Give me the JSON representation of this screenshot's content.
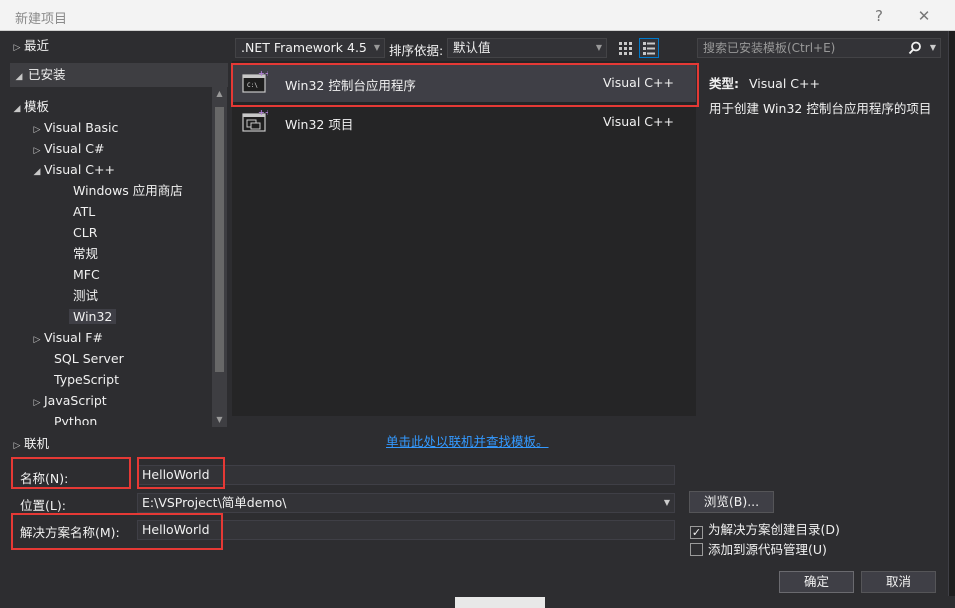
{
  "window": {
    "title": "新建项目",
    "help_glyph": "?",
    "close_glyph": "✕"
  },
  "tree": {
    "recent": "最近",
    "installed": "已安装",
    "templates": "模板",
    "items": [
      "Visual Basic",
      "Visual C#",
      "Visual C++",
      "Windows 应用商店",
      "ATL",
      "CLR",
      "常规",
      "MFC",
      "测试",
      "Win32",
      "Visual F#",
      "SQL Server",
      "TypeScript",
      "JavaScript",
      "Python"
    ],
    "online": "联机"
  },
  "toolbar": {
    "framework": ".NET Framework 4.5",
    "sort_label": "排序依据:",
    "sort_value": "默认值",
    "search_placeholder": "搜索已安装模板(Ctrl+E)"
  },
  "templates": [
    {
      "name": "Win32 控制台应用程序",
      "lang": "Visual C++",
      "icon": "console-app-icon"
    },
    {
      "name": "Win32 项目",
      "lang": "Visual C++",
      "icon": "win32-project-icon"
    }
  ],
  "online_link": "单击此处以联机并查找模板。",
  "details": {
    "type_label": "类型:",
    "type_value": "Visual C++",
    "description": "用于创建 Win32 控制台应用程序的项目"
  },
  "form": {
    "name_label": "名称(N):",
    "name_value": "HelloWorld",
    "location_label": "位置(L):",
    "location_value": "E:\\VSProject\\简单demo\\",
    "solution_label": "解决方案名称(M):",
    "solution_value": "HelloWorld",
    "browse": "浏览(B)...",
    "create_dir": "为解决方案创建目录(D)",
    "create_dir_checked": true,
    "add_scm": "添加到源代码管理(U)",
    "add_scm_checked": false,
    "ok": "确定",
    "cancel": "取消"
  },
  "colors": {
    "accent": "#007acc",
    "highlight_box": "#e53935",
    "link": "#3399ff",
    "cpp_badge": "#b180d7"
  }
}
